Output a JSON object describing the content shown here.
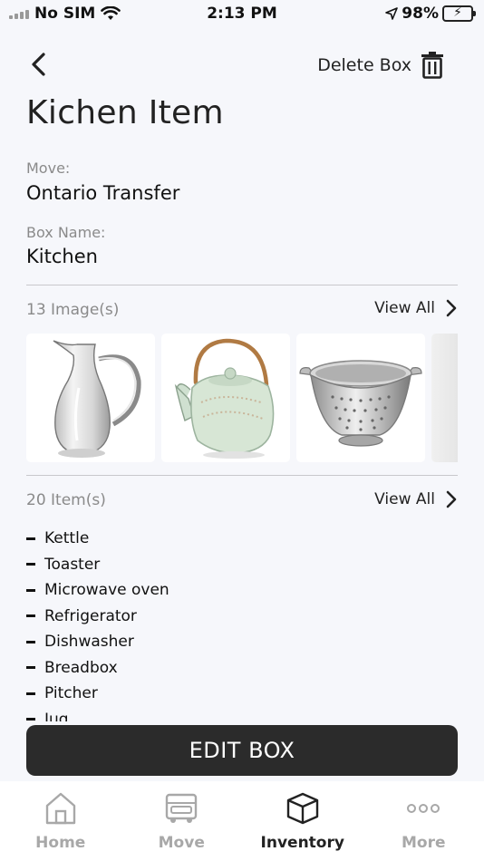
{
  "status_bar": {
    "carrier": "No SIM",
    "time": "2:13 PM",
    "battery": "98%"
  },
  "header": {
    "delete_label": "Delete Box",
    "title": "Kichen Item"
  },
  "fields": {
    "move_label": "Move:",
    "move_value": "Ontario Transfer",
    "box_name_label": "Box Name:",
    "box_name_value": "Kitchen"
  },
  "images_section": {
    "count_label": "13 Image(s)",
    "view_all": "View All",
    "thumbnails": [
      "glass-pitcher",
      "ceramic-teapot",
      "steel-colander",
      "partial-image"
    ]
  },
  "items_section": {
    "count_label": "20 Item(s)",
    "view_all": "View All",
    "items": [
      "Kettle",
      "Toaster",
      "Microwave oven",
      "Refrigerator",
      "Dishwasher",
      "Breadbox",
      "Pitcher",
      "Jug"
    ]
  },
  "edit_button": "EDIT BOX",
  "tabs": [
    {
      "label": "Home",
      "icon": "home-icon",
      "active": false
    },
    {
      "label": "Move",
      "icon": "truck-icon",
      "active": false
    },
    {
      "label": "Inventory",
      "icon": "box-icon",
      "active": true
    },
    {
      "label": "More",
      "icon": "more-icon",
      "active": false
    }
  ],
  "colors": {
    "background": "#F6F7FB",
    "button_dark": "#2B2B2B",
    "muted_text": "#8A8A8A",
    "inactive_tab": "#A8A8A8",
    "battery_green": "#34C759"
  }
}
